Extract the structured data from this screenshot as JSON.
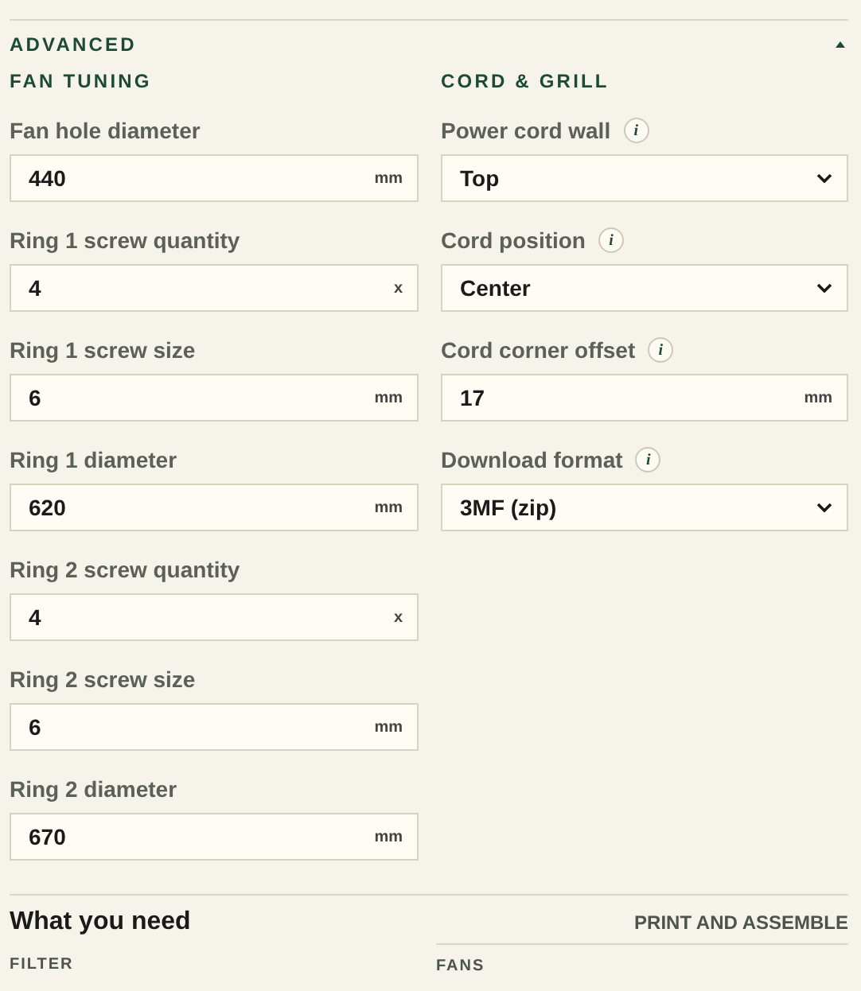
{
  "section": {
    "title": "ADVANCED",
    "expanded": true
  },
  "columns": [
    {
      "heading": "FAN TUNING",
      "fields": [
        {
          "kind": "number",
          "label": "Fan hole diameter",
          "value": "440",
          "unit": "mm"
        },
        {
          "kind": "number",
          "label": "Ring 1 screw quantity",
          "value": "4",
          "unit": "x"
        },
        {
          "kind": "number",
          "label": "Ring 1 screw size",
          "value": "6",
          "unit": "mm"
        },
        {
          "kind": "number",
          "label": "Ring 1 diameter",
          "value": "620",
          "unit": "mm"
        },
        {
          "kind": "number",
          "label": "Ring 2 screw quantity",
          "value": "4",
          "unit": "x"
        },
        {
          "kind": "number",
          "label": "Ring 2 screw size",
          "value": "6",
          "unit": "mm"
        },
        {
          "kind": "number",
          "label": "Ring 2 diameter",
          "value": "670",
          "unit": "mm"
        }
      ]
    },
    {
      "heading": "CORD & GRILL",
      "fields": [
        {
          "kind": "select",
          "label": "Power cord wall",
          "value": "Top",
          "info": "i"
        },
        {
          "kind": "select",
          "label": "Cord position",
          "value": "Center",
          "info": "i"
        },
        {
          "kind": "number",
          "label": "Cord corner offset",
          "value": "17",
          "unit": "mm",
          "info": "i"
        },
        {
          "kind": "select",
          "label": "Download format",
          "value": "3MF (zip)",
          "info": "i"
        }
      ]
    }
  ],
  "needs": {
    "title": "What you need",
    "link": "PRINT AND ASSEMBLE",
    "groups": [
      "FILTER",
      "FANS"
    ]
  }
}
